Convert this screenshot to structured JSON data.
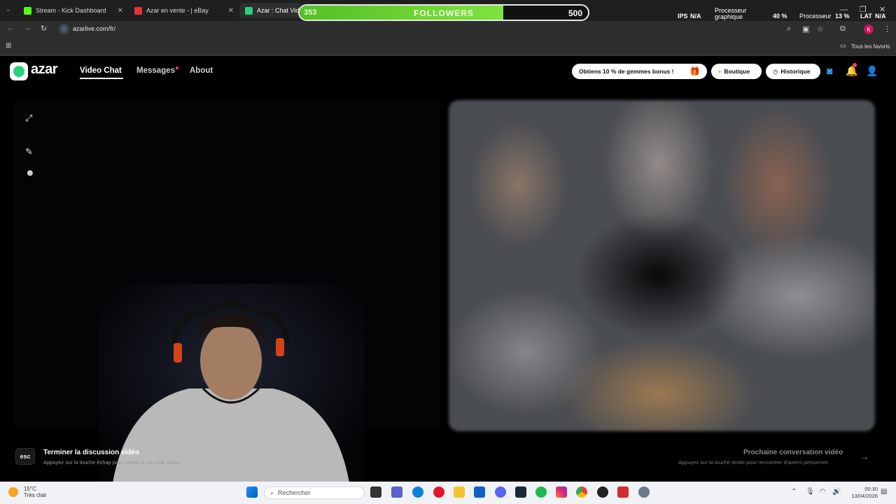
{
  "browser": {
    "tabs": [
      {
        "title": "Stream - Kick Dashboard",
        "color": "#53fc18"
      },
      {
        "title": "Azar en vente - | eBay",
        "color": "#e53238"
      },
      {
        "title": "Azar : Chat Vidéo",
        "color": "#28d17c"
      }
    ],
    "url": "azarlive.com/fr/",
    "bookmarks_label": "Tous les favoris"
  },
  "overlay": {
    "followers_current": 353,
    "followers_goal": 500,
    "followers_label": "FOLLOWERS",
    "progress_fraction": 0.706,
    "ips_label": "IPS",
    "ips_value": "N/A",
    "gpu_label_line1": "Processeur",
    "gpu_label_line2": "graphique",
    "gpu_value": "40 %",
    "cpu_label": "Processeur",
    "cpu_value": "13 %",
    "lat_label": "LAT",
    "lat_value": "N/A"
  },
  "site": {
    "logo_text": "azar",
    "nav": [
      "Video Chat",
      "Messages",
      "About"
    ],
    "promo": "Obtiens 10 % de gemmes bonus !",
    "shop": "Boutique",
    "history": "Historique"
  },
  "bottom": {
    "esc_key": "esc",
    "end_title": "Terminer la discussion vidéo",
    "end_sub": "Appuyez sur la touche échap pour mettre fin au chat vidéo.",
    "next_title": "Prochaine conversation vidéo",
    "next_sub": "Appuyez sur la touche droite pour rencontrer d'autres personnes"
  },
  "taskbar": {
    "temp": "15°C",
    "weather": "Très clair",
    "search_placeholder": "Rechercher",
    "time": "00:30",
    "date": "13/04/2026"
  }
}
